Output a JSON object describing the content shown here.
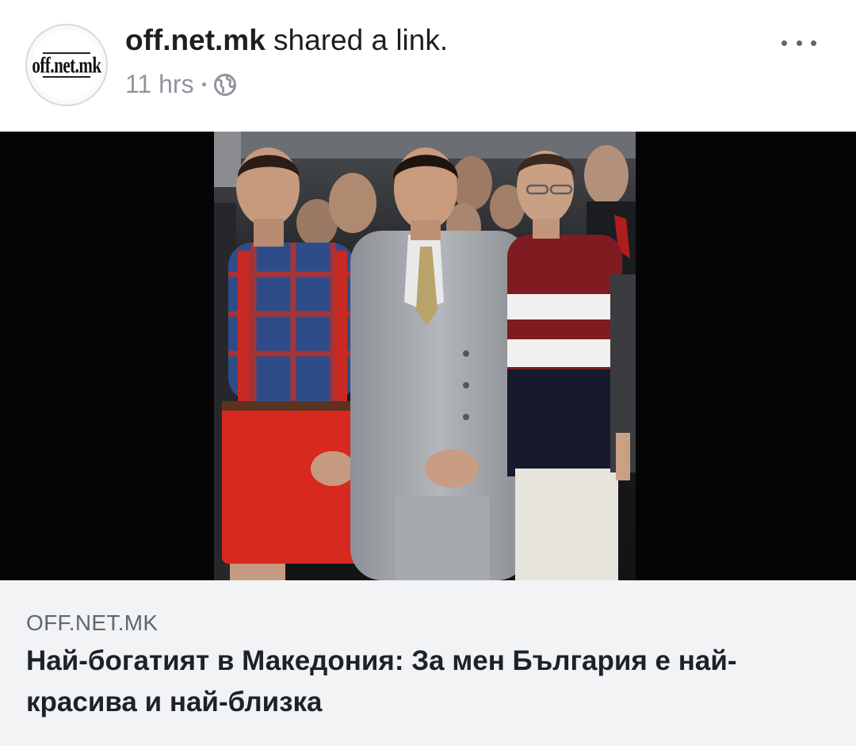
{
  "post": {
    "page_name": "off.net.mk",
    "action_text": " shared a link.",
    "time": "11 hrs",
    "privacy_icon": "globe-icon",
    "more_icon": "more-options-icon",
    "avatar_text": "off.net.mk"
  },
  "link_preview": {
    "domain": "OFF.NET.MK",
    "headline": "Най-богатият в Македония: За мен България е най-красива и най-близка"
  },
  "colors": {
    "text_primary": "#1c1e21",
    "text_secondary": "#90949c",
    "card_background": "#f2f3f5",
    "image_background": "#050505"
  }
}
